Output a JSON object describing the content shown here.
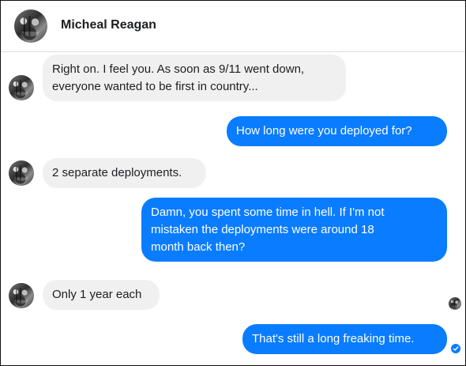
{
  "header": {
    "contact_name": "Micheal Reagan",
    "avatar_icon": "contact-profile-photo"
  },
  "messages": [
    {
      "direction": "incoming",
      "text": "Right on. I feel you. As soon as 9/11 went down,\neveryone wanted to be first in country..."
    },
    {
      "direction": "outgoing",
      "text": "How long were you deployed for?"
    },
    {
      "direction": "incoming",
      "text": "2 separate deployments."
    },
    {
      "direction": "outgoing",
      "text": "Damn, you spent some time in hell. If I'm not\nmistaken the deployments were around 18\nmonth back then?"
    },
    {
      "direction": "incoming",
      "text": "Only 1 year each"
    },
    {
      "direction": "outgoing",
      "text": "That's still a long freaking time."
    }
  ],
  "status": {
    "seen_avatar_icon": "contact-profile-photo",
    "delivered_icon": "check-circle-icon"
  },
  "colors": {
    "outgoing_bubble": "#0a7cff",
    "incoming_bubble": "#f1f0f0",
    "text_dark": "#1c1e21",
    "text_light": "#ffffff"
  }
}
